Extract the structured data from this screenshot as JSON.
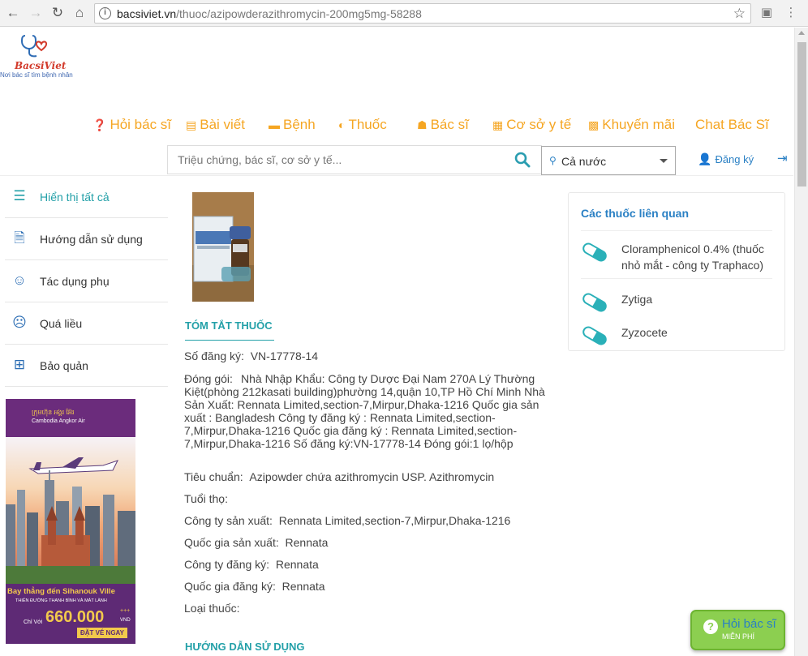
{
  "browser": {
    "url_host": "bacsiviet.vn",
    "url_path": "/thuoc/azipowderazithromycin-200mg5mg-58288"
  },
  "logo": {
    "name": "BacsiViet",
    "slogan": "Nơi bác sĩ tìm bệnh nhân"
  },
  "nav": [
    {
      "label": "Hỏi bác sĩ",
      "icon": "question-circle-icon"
    },
    {
      "label": "Bài viết",
      "icon": "newspaper-icon"
    },
    {
      "label": "Bệnh",
      "icon": "bed-icon"
    },
    {
      "label": "Thuốc",
      "icon": "toggle-icon"
    },
    {
      "label": "Bác sĩ",
      "icon": "user-md-icon"
    },
    {
      "label": "Cơ sở y tế",
      "icon": "hospital-icon"
    },
    {
      "label": "Khuyến mãi",
      "icon": "gift-icon"
    },
    {
      "label": "Chat Bác Sĩ",
      "icon": ""
    }
  ],
  "search": {
    "placeholder": "Triệu chứng, bác sĩ, cơ sở y tế...",
    "location": "Cả nước"
  },
  "account": {
    "register": "Đăng ký"
  },
  "sidebar": [
    {
      "label": "Hiển thị tất cả",
      "icon": "list-icon"
    },
    {
      "label": "Hướng dẫn sử dụng",
      "icon": "document-icon"
    },
    {
      "label": "Tác dụng phụ",
      "icon": "meh-face-icon"
    },
    {
      "label": "Quá liều",
      "icon": "frown-face-icon"
    },
    {
      "label": "Bảo quản",
      "icon": "medkit-icon"
    }
  ],
  "ad": {
    "brand_khmer": "ក្រុមហ៊ុន អង្គរ អ៊ែរ",
    "brand": "Cambodia Angkor Air",
    "headline": "Bay thẳng đến Sihanouk Ville",
    "sub": "THIÊN ĐƯỜNG THANH BÌNH VÀ MÁT LÀNH",
    "price_prefix": "Chỉ Với",
    "price": "660.000",
    "price_suffix": "+++",
    "currency": "VND",
    "cta": "ĐẶT VÉ NGAY"
  },
  "summary": {
    "title": "TÓM TẮT THUỐC",
    "registration_label": "Số đăng ký:",
    "registration_value": "VN-17778-14",
    "packaging_label": "Đóng gói:",
    "packaging_value": "Nhà Nhập Khẩu: Công ty Dược Đại Nam 270A Lý Thường Kiệt(phòng 212kasati building)phường 14,quận 10,TP Hồ Chí Minh Nhà Sản Xuất: Rennata Limited,section-7,Mirpur,Dhaka-1216 Quốc gia sản xuất : Bangladesh Công ty đăng ký : Rennata Limited,section-7,Mirpur,Dhaka-1216 Quốc gia đăng ký : Rennata Limited,section-7,Mirpur,Dhaka-1216 Số đăng ký:VN-17778-14 Đóng gói:1 lọ/hộp",
    "standard_label": "Tiêu chuẩn:",
    "standard_value": "Azipowder chứa azithromycin USP. Azithromycin",
    "shelf_label": "Tuổi thọ:",
    "shelf_value": "",
    "maker_label": "Công ty sản xuất:",
    "maker_value": "Rennata Limited,section-7,Mirpur,Dhaka-1216",
    "maker_country_label": "Quốc gia sản xuất:",
    "maker_country_value": "Rennata",
    "reg_company_label": "Công ty đăng ký:",
    "reg_company_value": "Rennata",
    "reg_country_label": "Quốc gia đăng ký:",
    "reg_country_value": "Rennata",
    "type_label": "Loại thuốc:",
    "type_value": ""
  },
  "usage": {
    "title": "HƯỚNG DẪN SỬ DỤNG"
  },
  "related": {
    "title": "Các thuốc liên quan",
    "items": [
      "Cloramphenicol 0.4% (thuốc nhỏ mắt - công ty Traphaco)",
      "Zytiga",
      "Zyzocete"
    ]
  },
  "float_button": {
    "label": "Hỏi bác sĩ",
    "sub": "MIỄN PHÍ"
  },
  "colors": {
    "nav": "#f5a623",
    "teal": "#23a0a8",
    "blue": "#2a80c4",
    "float_bg": "#8ccf50"
  }
}
